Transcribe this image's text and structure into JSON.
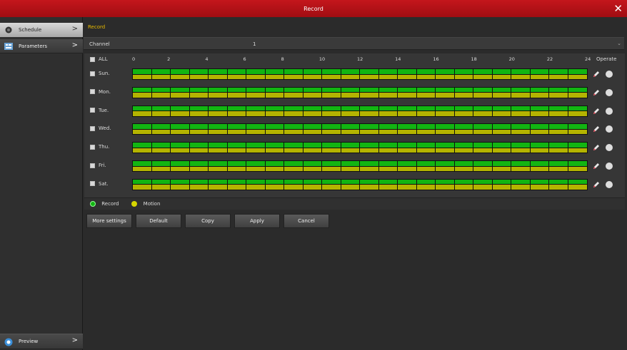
{
  "window": {
    "title": "Record",
    "close_glyph": "✕"
  },
  "sidebar": {
    "items": [
      {
        "label": "Schedule",
        "icon": "camera-icon",
        "chevron": ">"
      },
      {
        "label": "Parameters",
        "icon": "parameters-icon",
        "chevron": ">"
      },
      {
        "label": "Preview",
        "icon": "preview-icon",
        "chevron": ">"
      }
    ]
  },
  "main": {
    "section_title": "Record",
    "channel": {
      "label": "Channel",
      "value": "1",
      "dropdown_glyph": "⌄"
    },
    "schedule": {
      "all_label": "ALL",
      "operate_label": "Operate",
      "ticks": [
        "0",
        "2",
        "4",
        "6",
        "8",
        "10",
        "12",
        "14",
        "16",
        "18",
        "20",
        "22",
        "24"
      ],
      "days": [
        "Sun.",
        "Mon.",
        "Tue.",
        "Wed.",
        "Thu.",
        "Fri.",
        "Sat."
      ],
      "hours_per_day": 24,
      "record_color": "#12b512",
      "motion_color": "#b4b400"
    },
    "legend": {
      "record_label": "Record",
      "motion_label": "Motion"
    },
    "buttons": {
      "more_settings": "More settings",
      "default": "Default",
      "copy": "Copy",
      "apply": "Apply",
      "cancel": "Cancel"
    }
  },
  "colors": {
    "accent": "#c4161c",
    "title_yellow": "#e6b800"
  }
}
